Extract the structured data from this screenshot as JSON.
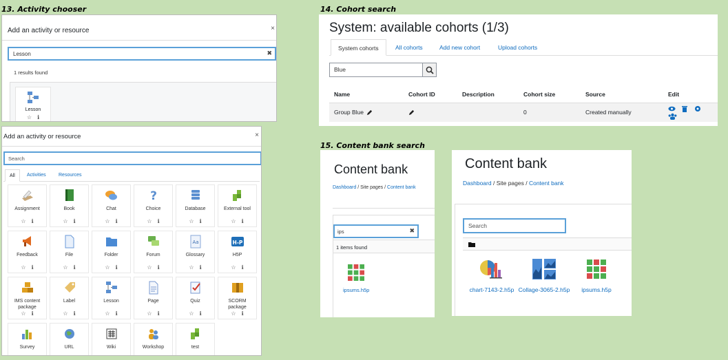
{
  "captions": {
    "activity_chooser": "13. Activity chooser",
    "cohort_search": "14. Cohort search",
    "content_bank_search": "15. Content bank search"
  },
  "chooser_small": {
    "title": "Add an activity or resource",
    "close": "×",
    "search_value": "Lesson",
    "clear": "✖",
    "results_text": "1 results found",
    "result_item": {
      "label": "Lesson",
      "icon": "lesson-icon"
    }
  },
  "chooser_big": {
    "title": "Add an activity or resource",
    "close": "×",
    "search_placeholder": "Search",
    "tabs": [
      "All",
      "Activities",
      "Resources"
    ],
    "items": [
      {
        "label": "Assignment",
        "icon": "assignment-icon"
      },
      {
        "label": "Book",
        "icon": "book-icon"
      },
      {
        "label": "Chat",
        "icon": "chat-icon"
      },
      {
        "label": "Choice",
        "icon": "choice-icon"
      },
      {
        "label": "Database",
        "icon": "database-icon"
      },
      {
        "label": "External tool",
        "icon": "puzzle-icon"
      },
      {
        "label": "Feedback",
        "icon": "megaphone-icon"
      },
      {
        "label": "File",
        "icon": "file-icon"
      },
      {
        "label": "Folder",
        "icon": "folder-icon"
      },
      {
        "label": "Forum",
        "icon": "forum-icon"
      },
      {
        "label": "Glossary",
        "icon": "glossary-icon"
      },
      {
        "label": "H5P",
        "icon": "h5p-icon"
      },
      {
        "label": "IMS content\npackage",
        "icon": "ims-icon"
      },
      {
        "label": "Label",
        "icon": "label-icon"
      },
      {
        "label": "Lesson",
        "icon": "lesson-icon"
      },
      {
        "label": "Page",
        "icon": "page-icon"
      },
      {
        "label": "Quiz",
        "icon": "quiz-icon"
      },
      {
        "label": "SCORM\npackage",
        "icon": "scorm-icon"
      },
      {
        "label": "Survey",
        "icon": "survey-icon"
      },
      {
        "label": "URL",
        "icon": "url-icon"
      },
      {
        "label": "Wiki",
        "icon": "wiki-icon"
      },
      {
        "label": "Workshop",
        "icon": "workshop-icon"
      },
      {
        "label": "test",
        "icon": "puzzle-icon"
      }
    ]
  },
  "cohorts": {
    "title": "System: available cohorts (1/3)",
    "tabs": [
      "System cohorts",
      "All cohorts",
      "Add new cohort",
      "Upload cohorts"
    ],
    "search_value": "Blue",
    "columns": [
      "Name",
      "Cohort ID",
      "Description",
      "Cohort size",
      "Source",
      "Edit"
    ],
    "rows": [
      {
        "name": "Group Blue",
        "cohort_id": "",
        "description": "",
        "size": "0",
        "source": "Created manually"
      }
    ],
    "colors": {
      "edit_icon": "#0f6cbf"
    }
  },
  "content_bank_small": {
    "title": "Content bank",
    "breadcrumb": [
      "Dashboard",
      "Site pages",
      "Content bank"
    ],
    "search_value": "ips",
    "clear": "✖",
    "found_text": "1 items found",
    "files": [
      {
        "name": "ipsums.h5p",
        "icon": "h5p-grid-icon"
      }
    ]
  },
  "content_bank_large": {
    "title": "Content bank",
    "breadcrumb": [
      "Dashboard",
      "Site pages",
      "Content bank"
    ],
    "search_placeholder": "Search",
    "files": [
      {
        "name": "chart-7143-2.h5p",
        "icon": "chart-icon"
      },
      {
        "name": "Collage-3065-2.h5p",
        "icon": "collage-icon"
      },
      {
        "name": "ipsums.h5p",
        "icon": "h5p-grid-icon"
      }
    ]
  }
}
